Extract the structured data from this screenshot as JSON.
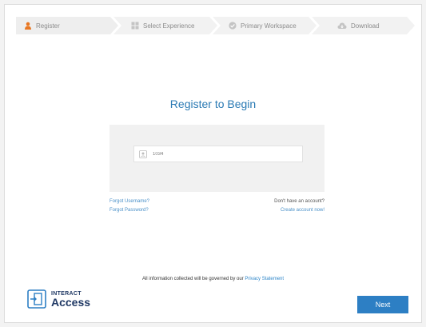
{
  "steps": [
    {
      "label": "Register",
      "icon": "user-icon",
      "active": true
    },
    {
      "label": "Select Experience",
      "icon": "grid-icon",
      "active": false
    },
    {
      "label": "Primary Workspace",
      "icon": "check-circle-icon",
      "active": false
    },
    {
      "label": "Download",
      "icon": "cloud-download-icon",
      "active": false
    }
  ],
  "main": {
    "title": "Register to Begin",
    "username_value": "1034"
  },
  "links": {
    "forgot_username": "Forgot Username?",
    "forgot_password": "Forgot Password?",
    "no_account": "Don't have an account?",
    "create_account": "Create account now!"
  },
  "footer": {
    "privacy_text": "All information collected will be governed by our ",
    "privacy_link": "Privacy Statement",
    "logo_top": "INTERACT",
    "logo_bottom": "Access",
    "next_label": "Next"
  },
  "colors": {
    "accent": "#2d7fc4",
    "title": "#2a7ab4",
    "step_active_icon": "#e87722",
    "brand": "#1f3864"
  }
}
